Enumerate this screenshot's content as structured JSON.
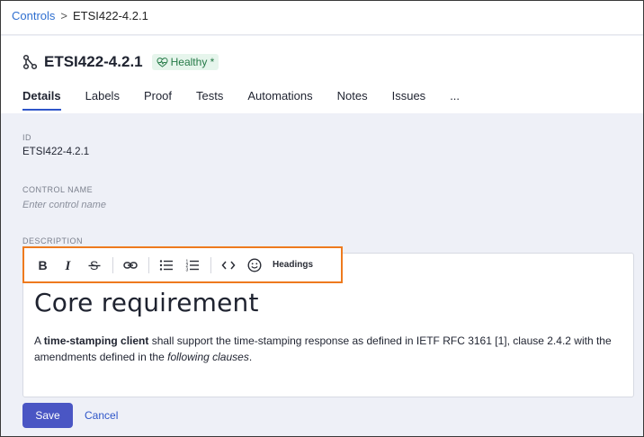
{
  "breadcrumb": {
    "parent": "Controls",
    "separator": ">",
    "current": "ETSI422-4.2.1"
  },
  "header": {
    "icon": "hierarchy-icon",
    "title": "ETSI422-4.2.1",
    "status_badge": "Healthy *",
    "status_color": "#257a47"
  },
  "tabs": [
    {
      "label": "Details",
      "active": true
    },
    {
      "label": "Labels"
    },
    {
      "label": "Proof"
    },
    {
      "label": "Tests"
    },
    {
      "label": "Automations"
    },
    {
      "label": "Notes"
    },
    {
      "label": "Issues"
    },
    {
      "label": "..."
    }
  ],
  "fields": {
    "id_label": "ID",
    "id_value": "ETSI422-4.2.1",
    "control_name_label": "CONTROL NAME",
    "control_name_placeholder": "Enter control name",
    "description_label": "DESCRIPTION"
  },
  "toolbar": {
    "buttons": [
      "bold-icon",
      "italic-icon",
      "strikethrough-icon",
      "link-icon",
      "bullet-list-icon",
      "numbered-list-icon",
      "code-icon",
      "emoji-icon"
    ],
    "headings_label": "Headings",
    "highlight_color": "#ee7a1e"
  },
  "editor": {
    "heading": "Core requirement",
    "para_prefix": "A ",
    "para_bold": "time-stamping client",
    "para_middle": " shall support the time-stamping response as defined in IETF RFC 3161 [1], clause 2.4.2 with the amendments defined in the ",
    "para_italic": "following clauses",
    "para_suffix": "."
  },
  "actions": {
    "save_label": "Save",
    "cancel_label": "Cancel",
    "accent": "#4a56c4"
  }
}
